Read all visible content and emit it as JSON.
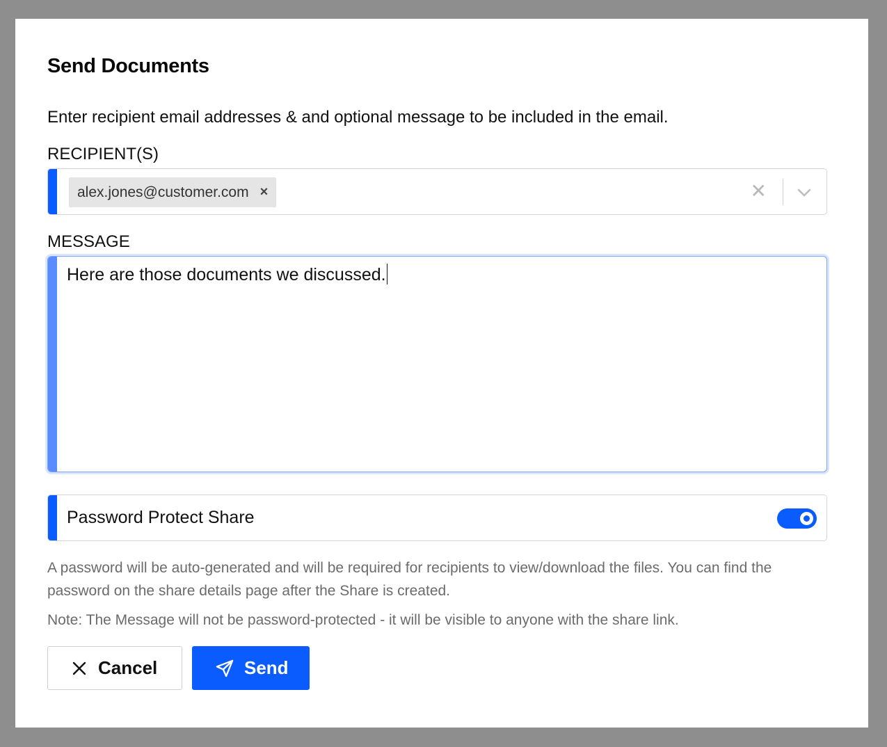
{
  "dialog": {
    "title": "Send Documents",
    "intro": "Enter recipient email addresses & and optional message to be included in the email."
  },
  "recipients": {
    "label": "RECIPIENT(S)",
    "chips": [
      "alex.jones@customer.com"
    ],
    "chip_remove_glyph": "×",
    "clear_glyph": "✕",
    "icons": [
      "close-icon",
      "chevron-down-icon"
    ]
  },
  "message": {
    "label": "MESSAGE",
    "value": "Here are those documents we discussed."
  },
  "password_protect": {
    "label": "Password Protect Share",
    "enabled": true,
    "help": "A password will be auto-generated and will be required for recipients to view/download the files. You can find the password on the share details page after the Share is created.",
    "note": "Note: The Message will not be password-protected - it will be visible to anyone with the share link."
  },
  "actions": {
    "cancel_label": "Cancel",
    "send_label": "Send",
    "icons": [
      "close-icon",
      "paper-plane-icon"
    ]
  },
  "colors": {
    "accent": "#0a5cff",
    "focus_border": "#7aa3ff",
    "overlay": "#8e8e8e"
  }
}
